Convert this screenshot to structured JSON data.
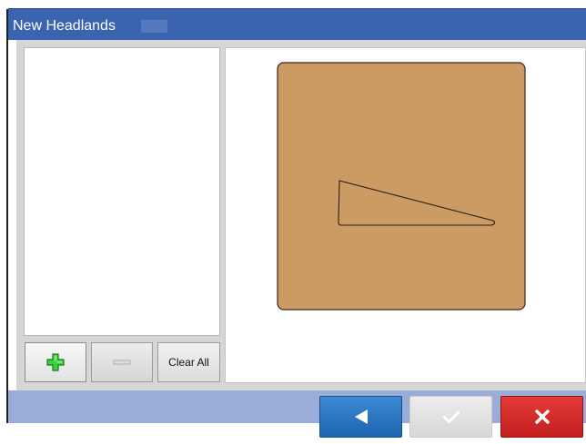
{
  "window": {
    "title": "New Headlands"
  },
  "list": {
    "items": []
  },
  "toolbar": {
    "add_icon": "plus-icon",
    "remove_icon": "minus-icon",
    "clear_all_label": "Clear All"
  },
  "footer": {
    "back_icon": "left-arrow-icon",
    "confirm_icon": "checkmark-icon",
    "cancel_icon": "x-icon"
  },
  "colors": {
    "title_bar": "#3a64b0",
    "footer_bar": "#9aadd9",
    "field_fill": "#cc9a63",
    "add_icon": "#22bb22",
    "back_button": "#1f64b0",
    "cancel_button": "#c41e1e"
  }
}
